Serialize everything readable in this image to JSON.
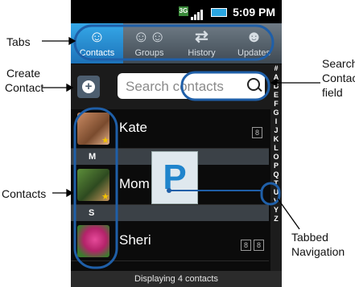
{
  "status_bar": {
    "time": "5:09 PM",
    "network": "3G"
  },
  "tabs": [
    {
      "label": "Contacts",
      "icon": "person-icon",
      "active": true
    },
    {
      "label": "Groups",
      "icon": "group-icon",
      "active": false
    },
    {
      "label": "History",
      "icon": "swap-arrows-icon",
      "active": false
    },
    {
      "label": "Updates",
      "icon": "person-update-icon",
      "active": false
    }
  ],
  "search": {
    "placeholder": "Search contacts"
  },
  "contacts": [
    {
      "name": "Kate",
      "favorite": true,
      "badges": [
        "8"
      ]
    },
    {
      "section": "M"
    },
    {
      "name": "Mom",
      "favorite": true,
      "badges": []
    },
    {
      "section": "S"
    },
    {
      "name": "Sheri",
      "favorite": false,
      "badges": [
        "8",
        "8"
      ]
    }
  ],
  "index_letters": [
    "#",
    "A",
    "B",
    "E",
    "F",
    "G",
    "I",
    "J",
    "K",
    "L",
    "O",
    "P",
    "Q",
    "T",
    "U",
    "V",
    "Y",
    "Z"
  ],
  "index_selected": "P",
  "popup_letter": "P",
  "footer": "Displaying 4 contacts",
  "callouts": {
    "tabs": "Tabs",
    "create_contact": "Create\nContact",
    "search_field": "Search\nContacts\nfield",
    "contacts": "Contacts",
    "tabbed_nav": "Tabbed\nNavigation"
  },
  "colors": {
    "accent": "#1d72b8",
    "callout_outline": "#1f5fa8"
  }
}
